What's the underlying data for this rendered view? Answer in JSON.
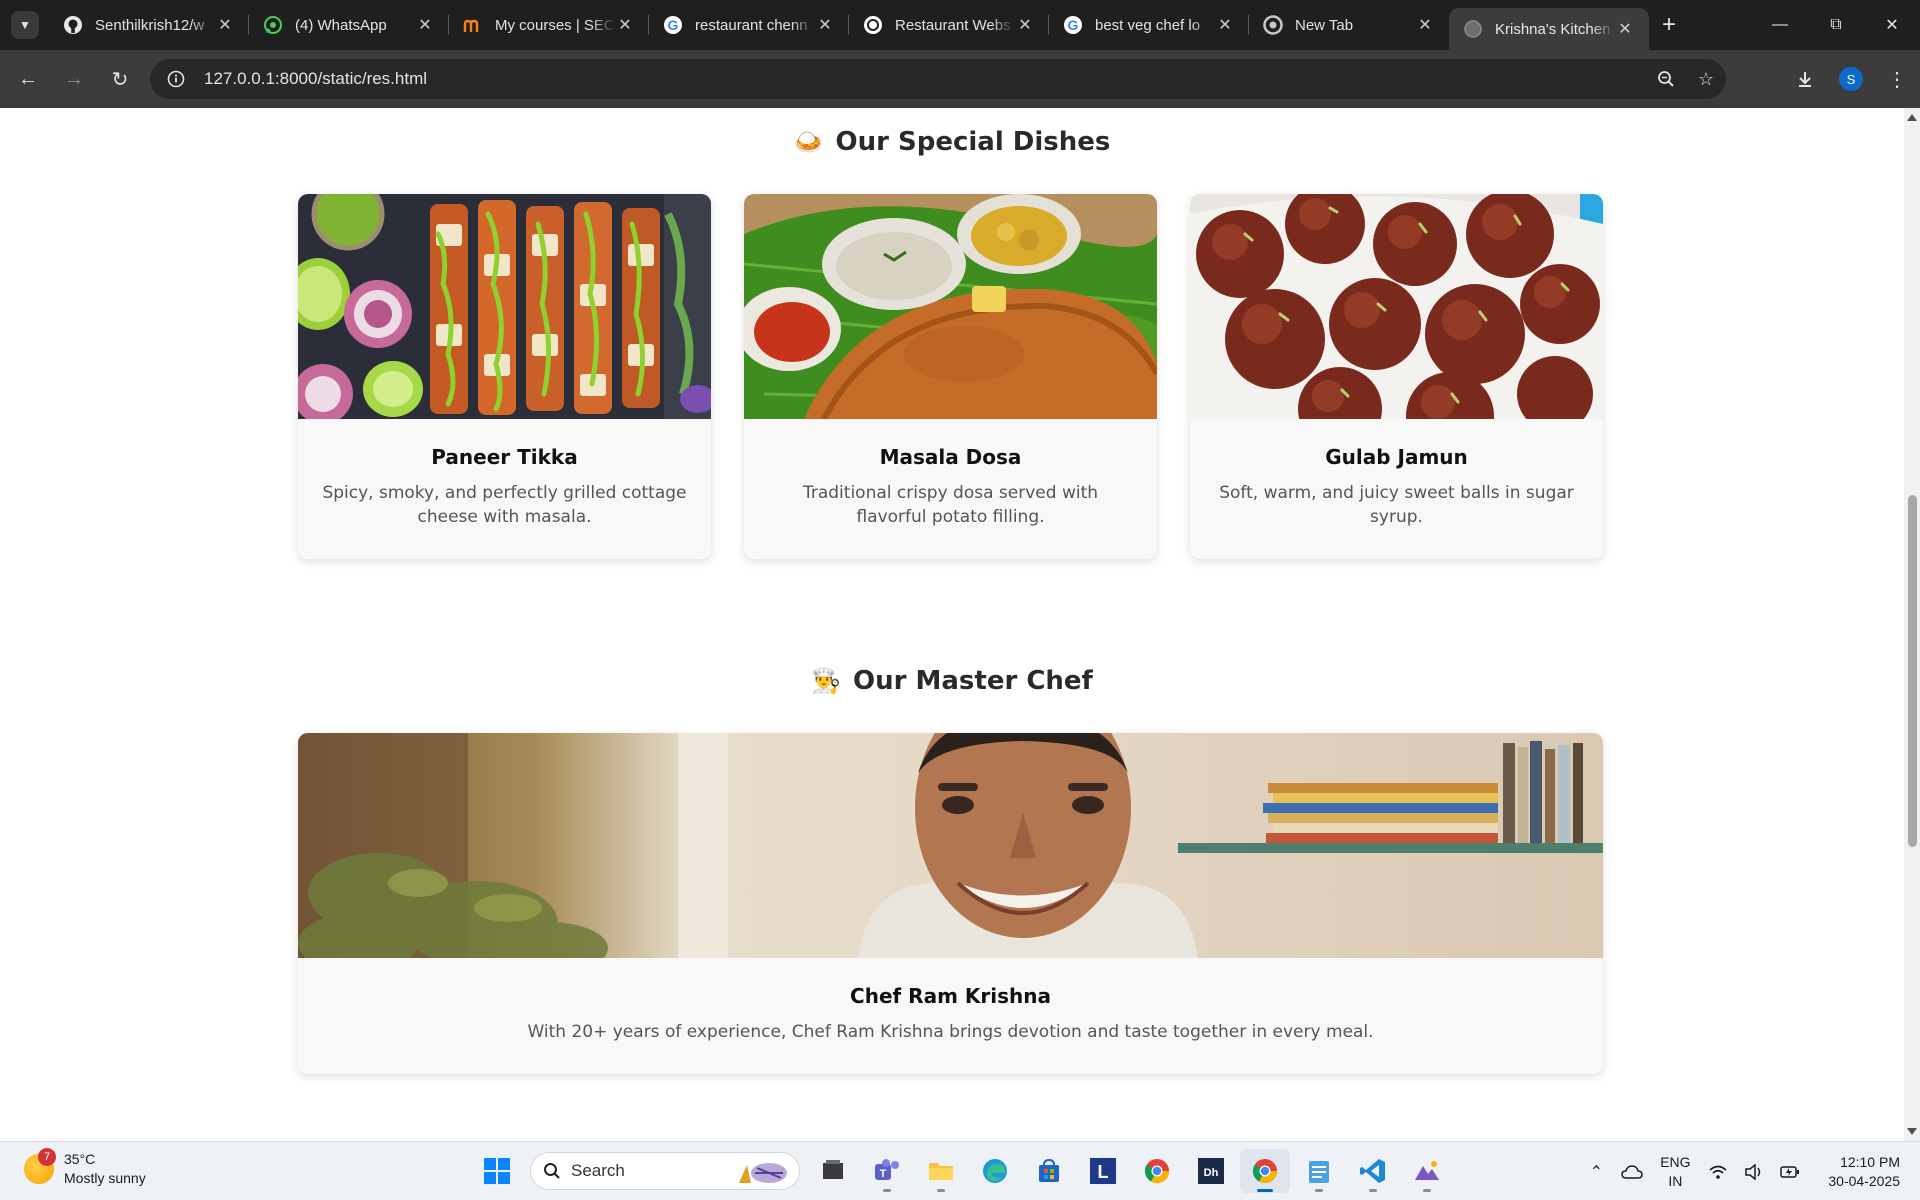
{
  "browser": {
    "tabs": [
      {
        "title": "Senthilkrish12/w",
        "icon": "github-icon",
        "active": false
      },
      {
        "title": "(4) WhatsApp",
        "icon": "whatsapp-icon",
        "active": false
      },
      {
        "title": "My courses | SEC",
        "icon": "moodle-icon",
        "active": false
      },
      {
        "title": "restaurant chenn",
        "icon": "google-icon",
        "active": false
      },
      {
        "title": "Restaurant Webs",
        "icon": "chatgpt-icon",
        "active": false
      },
      {
        "title": "best veg chef lo",
        "icon": "google-icon",
        "active": false
      },
      {
        "title": "New Tab",
        "icon": "chrome-icon",
        "active": false
      },
      {
        "title": "Krishna's Kitchen",
        "icon": "globe-icon",
        "active": true
      }
    ],
    "url": "127.0.0.1:8000/static/res.html",
    "profile_initial": "S"
  },
  "page": {
    "special_section": {
      "emoji": "🍛",
      "title": "Our Special Dishes",
      "dishes": [
        {
          "name": "Paneer Tikka",
          "description": "Spicy, smoky, and perfectly grilled cottage cheese with masala."
        },
        {
          "name": "Masala Dosa",
          "description": "Traditional crispy dosa served with flavorful potato filling."
        },
        {
          "name": "Gulab Jamun",
          "description": "Soft, warm, and juicy sweet balls in sugar syrup."
        }
      ]
    },
    "chef_section": {
      "emoji": "👨‍🍳",
      "title": "Our Master Chef",
      "chef": {
        "name": "Chef Ram Krishna",
        "description": "With 20+ years of experience, Chef Ram Krishna brings devotion and taste together in every meal."
      }
    }
  },
  "taskbar": {
    "weather": {
      "temp": "35°C",
      "condition": "Mostly sunny",
      "badge": "7"
    },
    "search_label": "Search",
    "lang": {
      "line1": "ENG",
      "line2": "IN"
    },
    "clock": {
      "time": "12:10 PM",
      "date": "30-04-2025"
    },
    "apps": [
      "start-icon",
      "search",
      "file-manager-icon",
      "teams-icon",
      "file-explorer-icon",
      "edge-icon",
      "store-icon",
      "l-app-icon",
      "chrome-icon",
      "app-icon",
      "chrome-active-icon",
      "notepad-icon",
      "vscode-icon",
      "photos-icon"
    ]
  },
  "colors": {
    "chrome_dark": "#1f1f1f",
    "toolbar": "#3c3c3c",
    "card_bg": "#f8f8f8",
    "accent": "#0067c0"
  }
}
